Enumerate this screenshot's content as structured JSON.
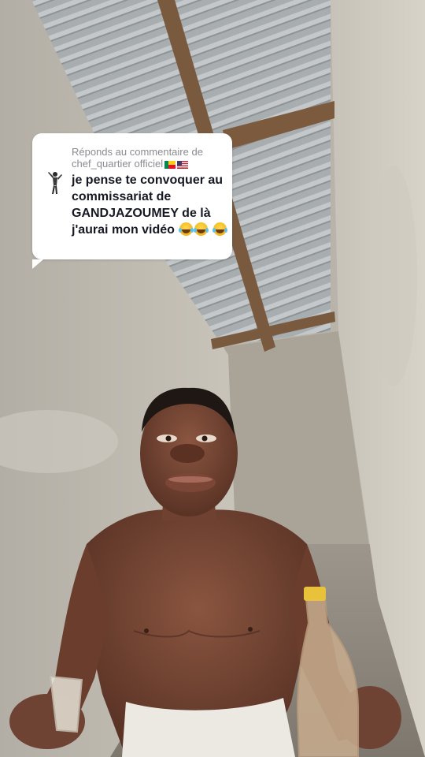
{
  "reply_card": {
    "header_prefix": "Réponds au commentaire de",
    "username": "chef_quartier officiel",
    "comment_text": "je pense te convoquer au commissariat de GANDJAZOUMEY de là j'aurai mon vidéo",
    "emojis": [
      "face-with-tears-of-joy-icon",
      "face-with-tears-of-joy-icon",
      "face-with-tears-of-joy-icon"
    ],
    "flags": [
      "benin-flag-icon",
      "usa-flag-icon"
    ]
  },
  "colors": {
    "card_bg": "#ffffff",
    "header_text": "#8a8b91",
    "comment_text": "#161823"
  }
}
